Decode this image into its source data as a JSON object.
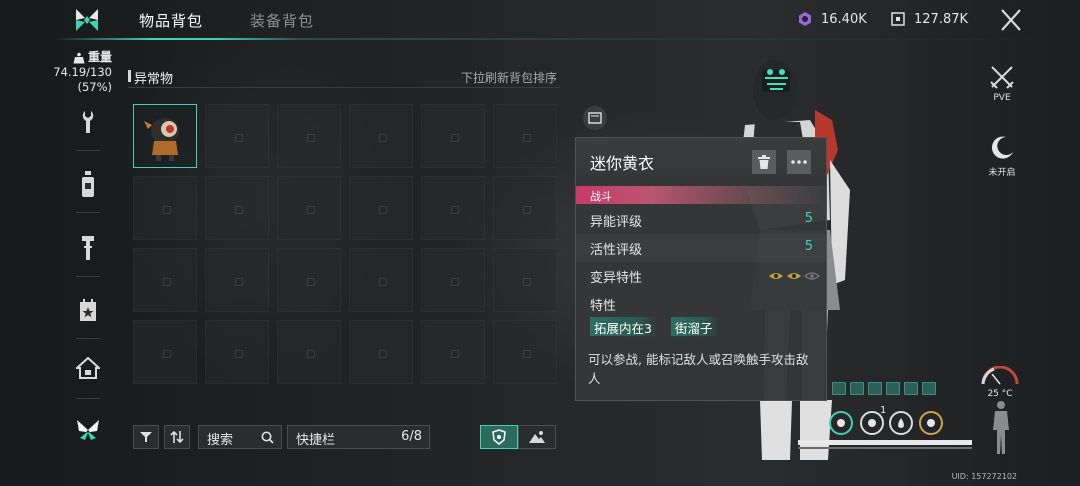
{
  "tabs": [
    {
      "label": "物品背包",
      "active": true
    },
    {
      "label": "装备背包",
      "active": false
    }
  ],
  "currency": [
    {
      "icon": "crystal-icon",
      "value": "16.40K",
      "color": "#b489e0"
    },
    {
      "icon": "chip-icon",
      "value": "127.87K",
      "color": "#e6e6e6"
    }
  ],
  "weight": {
    "label": "重量",
    "value": "74.19/130",
    "percent": "(57%)"
  },
  "sidebar": [
    {
      "icon": "wrench-icon"
    },
    {
      "icon": "bottle-icon"
    },
    {
      "icon": "tool-icon"
    },
    {
      "icon": "calendar-star-icon"
    },
    {
      "icon": "home-icon"
    },
    {
      "icon": "butterfly-icon",
      "active": true
    }
  ],
  "section": {
    "title": "异常物",
    "hint": "下拉刷新背包排序"
  },
  "grid": {
    "filled_index": 0,
    "item_name": "迷你黄衣"
  },
  "toolbar": {
    "search_label": "搜索",
    "quick_label": "快捷栏",
    "quick_count": "6/8"
  },
  "card": {
    "title": "迷你黄衣",
    "tag": "战斗",
    "rows": [
      {
        "label": "异能评级",
        "value": "5"
      },
      {
        "label": "活性评级",
        "value": "5"
      },
      {
        "label": "变异特性",
        "value": ""
      }
    ],
    "traits_label": "特性",
    "traits": [
      "拓展内在3",
      "街溜子"
    ],
    "description": "可以参战, 能标记敌人或召唤触手攻击敌人",
    "mutation_eyes": {
      "lit": 2,
      "total": 3
    },
    "accent": "#3fd3b4",
    "tag_color": "#c93a6a"
  },
  "right": {
    "pve_label": "PVE",
    "night_label": "未开启",
    "temperature": "25 °C",
    "uid": "UID: 157272102",
    "stat_badge": "1"
  }
}
